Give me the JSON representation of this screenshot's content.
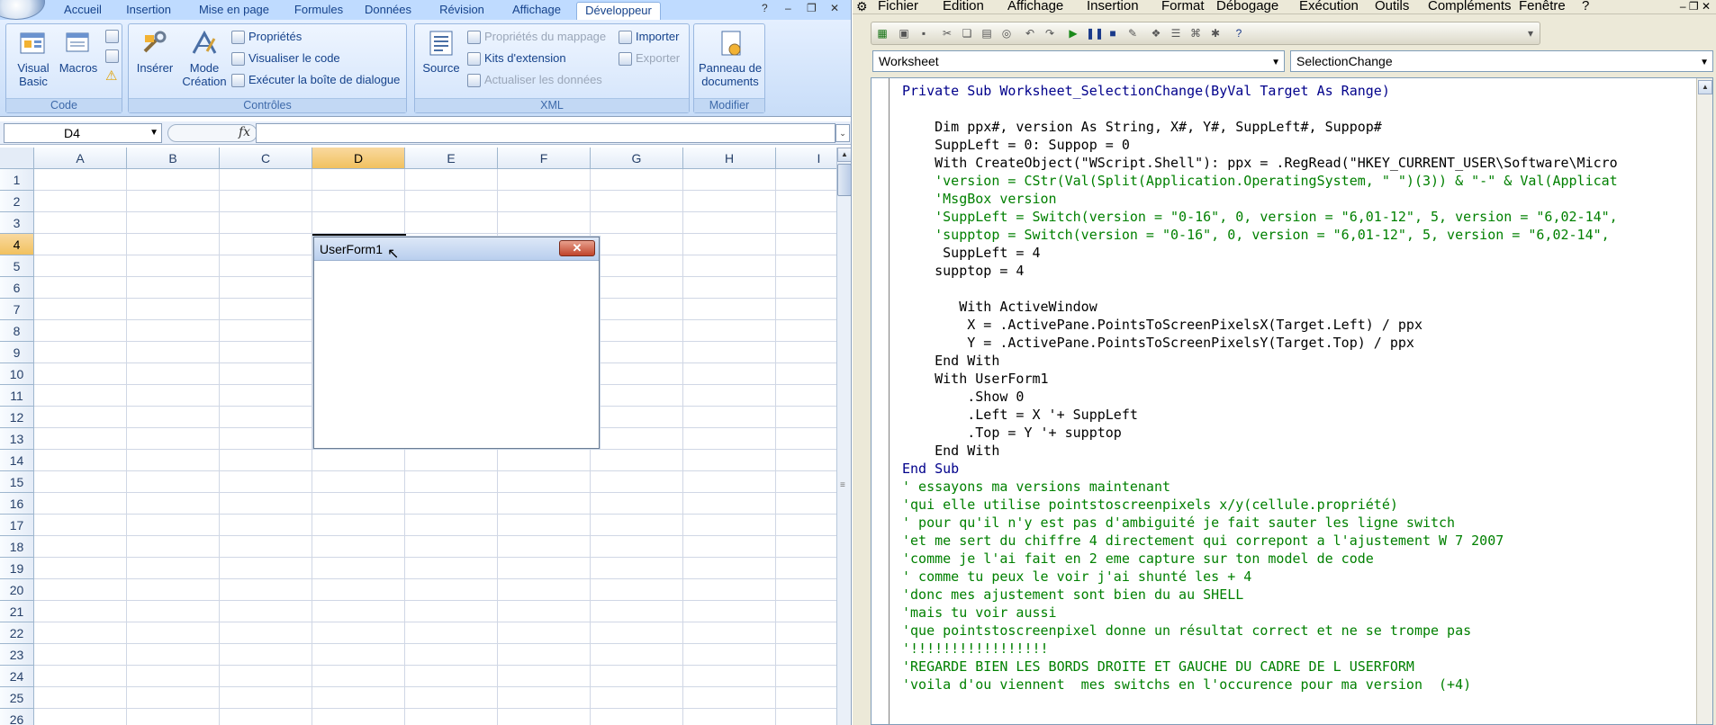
{
  "excel": {
    "tabs": [
      "Accueil",
      "Insertion",
      "Mise en page",
      "Formules",
      "Données",
      "Révision",
      "Affichage",
      "Développeur"
    ],
    "active_tab": "Développeur",
    "ribbon": {
      "code": {
        "label": "Code",
        "visual_basic": "Visual Basic",
        "macros": "Macros"
      },
      "controles": {
        "label": "Contrôles",
        "inserer": "Insérer",
        "mode_creation": "Mode Création",
        "proprietes": "Propriétés",
        "visualiser": "Visualiser le code",
        "executer": "Exécuter la boîte de dialogue"
      },
      "xml": {
        "label": "XML",
        "source": "Source",
        "proprietes_mappage": "Propriétés du mappage",
        "kits": "Kits d'extension",
        "actualiser": "Actualiser les données",
        "importer": "Importer",
        "exporter": "Exporter"
      },
      "modifier": {
        "label": "Modifier",
        "panneau": "Panneau de documents"
      }
    },
    "name_box": "D4",
    "fx_label": "fx",
    "columns": [
      "A",
      "B",
      "C",
      "D",
      "E",
      "F",
      "G",
      "H",
      "I"
    ],
    "selected_column": "D",
    "rows": [
      "1",
      "2",
      "3",
      "4",
      "5",
      "6",
      "7",
      "8",
      "9",
      "10",
      "11",
      "12",
      "13",
      "14",
      "15",
      "16",
      "17",
      "18",
      "19",
      "20",
      "21",
      "22",
      "23",
      "24",
      "25",
      "26"
    ],
    "selected_row": "4",
    "userform": {
      "title": "UserForm1",
      "close": "✕"
    }
  },
  "vbe": {
    "menu": [
      "Fichier",
      "Edition",
      "Affichage",
      "Insertion",
      "Format",
      "Débogage",
      "Exécution",
      "Outils",
      "Compléments",
      "Fenêtre",
      "?"
    ],
    "object_select": "Worksheet",
    "proc_select": "SelectionChange",
    "code_lines": [
      {
        "cls": "kw",
        "t": "Private Sub Worksheet_SelectionChange(ByVal Target As Range)"
      },
      {
        "cls": "",
        "t": ""
      },
      {
        "cls": "",
        "t": "    Dim ppx#, version As String, X#, Y#, SuppLeft#, Suppop#"
      },
      {
        "cls": "",
        "t": "    SuppLeft = 0: Suppop = 0"
      },
      {
        "cls": "",
        "t": "    With CreateObject(\"WScript.Shell\"): ppx = .RegRead(\"HKEY_CURRENT_USER\\Software\\Micro"
      },
      {
        "cls": "cm",
        "t": "    'version = CStr(Val(Split(Application.OperatingSystem, \" \")(3)) & \"-\" & Val(Applicat"
      },
      {
        "cls": "cm",
        "t": "    'MsgBox version"
      },
      {
        "cls": "cm",
        "t": "    'SuppLeft = Switch(version = \"0-16\", 0, version = \"6,01-12\", 5, version = \"6,02-14\","
      },
      {
        "cls": "cm",
        "t": "    'supptop = Switch(version = \"0-16\", 0, version = \"6,01-12\", 5, version = \"6,02-14\","
      },
      {
        "cls": "",
        "t": "     SuppLeft = 4"
      },
      {
        "cls": "",
        "t": "    supptop = 4"
      },
      {
        "cls": "",
        "t": ""
      },
      {
        "cls": "",
        "t": "       With ActiveWindow"
      },
      {
        "cls": "",
        "t": "        X = .ActivePane.PointsToScreenPixelsX(Target.Left) / ppx"
      },
      {
        "cls": "",
        "t": "        Y = .ActivePane.PointsToScreenPixelsY(Target.Top) / ppx"
      },
      {
        "cls": "",
        "t": "    End With"
      },
      {
        "cls": "",
        "t": "    With UserForm1"
      },
      {
        "cls": "",
        "t": "        .Show 0"
      },
      {
        "cls": "",
        "t": "        .Left = X '+ SuppLeft"
      },
      {
        "cls": "",
        "t": "        .Top = Y '+ supptop"
      },
      {
        "cls": "",
        "t": "    End With"
      },
      {
        "cls": "kw",
        "t": "End Sub"
      },
      {
        "cls": "cm",
        "t": "' essayons ma versions maintenant"
      },
      {
        "cls": "cm",
        "t": "'qui elle utilise pointstoscreenpixels x/y(cellule.propriété)"
      },
      {
        "cls": "cm",
        "t": "' pour qu'il n'y est pas d'ambiguité je fait sauter les ligne switch"
      },
      {
        "cls": "cm",
        "t": "'et me sert du chiffre 4 directement qui correpont a l'ajustement W 7 2007"
      },
      {
        "cls": "cm",
        "t": "'comme je l'ai fait en 2 eme capture sur ton model de code"
      },
      {
        "cls": "cm",
        "t": "' comme tu peux le voir j'ai shunté les + 4"
      },
      {
        "cls": "cm",
        "t": "'donc mes ajustement sont bien du au SHELL"
      },
      {
        "cls": "cm",
        "t": "'mais tu voir aussi"
      },
      {
        "cls": "cm",
        "t": "'que pointstoscreenpixel donne un résultat correct et ne se trompe pas"
      },
      {
        "cls": "cm",
        "t": "'!!!!!!!!!!!!!!!!!"
      },
      {
        "cls": "cm",
        "t": "'REGARDE BIEN LES BORDS DROITE ET GAUCHE DU CADRE DE L USERFORM"
      },
      {
        "cls": "cm",
        "t": "'voila d'ou viennent  mes switchs en l'occurence pour ma version  (+4)"
      }
    ]
  }
}
